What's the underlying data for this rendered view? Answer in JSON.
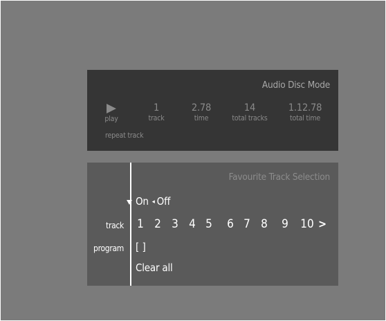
{
  "status": {
    "mode_title": "Audio Disc Mode",
    "play": {
      "icon": "play-icon",
      "label": "play"
    },
    "track": {
      "value": "1",
      "label": "track"
    },
    "time": {
      "value": "2.78",
      "label": "time"
    },
    "total_tracks": {
      "value": "14",
      "label": "total tracks"
    },
    "total_time": {
      "value": "1.12.78",
      "label": "total time"
    },
    "repeat_label": "repeat track",
    "text_color": "#8a8a8a"
  },
  "favourites": {
    "title": "Favourite Track Selection",
    "toggle_on": "On",
    "toggle_sep": "◂",
    "toggle_off": "Off",
    "track_label": "track",
    "program_label": "program",
    "tracks": [
      "1",
      "2",
      "3",
      "4",
      "5",
      "6",
      "7",
      "8",
      "9",
      "10"
    ],
    "next_arrow": ">",
    "program_value": "[ ]",
    "clear_all": "Clear all"
  },
  "colors": {
    "background": "#7b7b7b",
    "status_panel": "#353535",
    "favourites_panel": "#5a5a5a",
    "highlight": "#ffffff"
  }
}
